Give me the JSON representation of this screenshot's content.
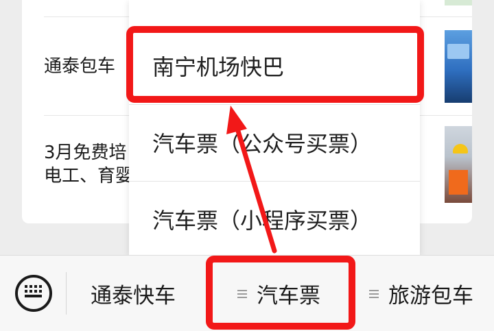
{
  "articles": [
    {
      "title": "通泰包车"
    },
    {
      "title_line1": "3月免费培",
      "title_line2": "电工、育婴"
    }
  ],
  "menu": {
    "items": [
      {
        "label": "南宁机场快巴"
      },
      {
        "label": "汽车票（公众号买票）"
      },
      {
        "label": "汽车票（小程序买票）"
      }
    ]
  },
  "bottombar": {
    "tabs": [
      {
        "label": "通泰快车",
        "has_menu_icon": false
      },
      {
        "label": "汽车票",
        "has_menu_icon": true
      },
      {
        "label": "旅游包车",
        "has_menu_icon": true
      }
    ]
  },
  "annotations": {
    "highlight_color": "#f21818"
  },
  "icons": {
    "keyboard": "keyboard-icon",
    "menu": "menu-icon"
  }
}
